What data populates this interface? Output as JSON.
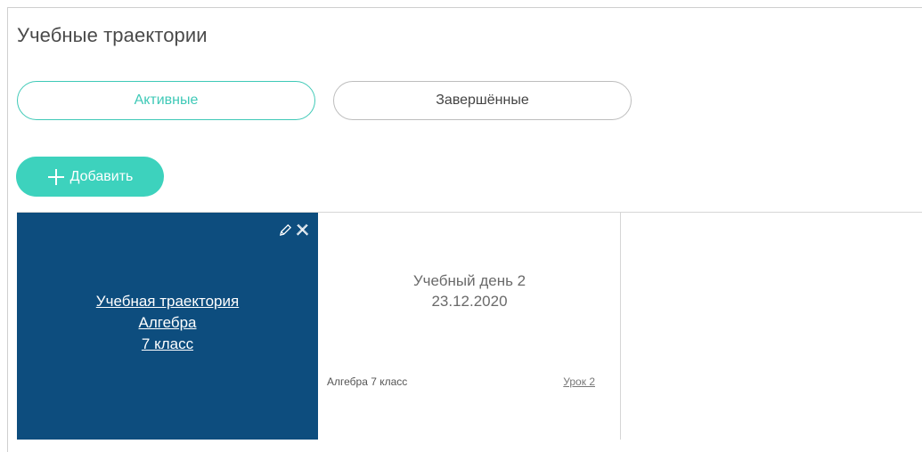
{
  "page": {
    "title": "Учебные траектории"
  },
  "tabs": [
    {
      "label": "Активные",
      "active": true
    },
    {
      "label": "Завершённые",
      "active": false
    }
  ],
  "add_button": {
    "label": "Добавить",
    "icon": "plus-icon"
  },
  "trajectory_card": {
    "line1": "Учебная траектория",
    "line2": "Алгебра",
    "line3": "7 класс",
    "tools": [
      "pencil-icon",
      "close-icon"
    ]
  },
  "day_card": {
    "title": "Учебный день 2",
    "date": "23.12.2020",
    "subject": "Алгебра 7 класс",
    "lesson": "Урок 2"
  },
  "colors": {
    "accent": "#3dd2bd",
    "card_bg": "#0d4d7e",
    "border": "#cfcfcf"
  }
}
